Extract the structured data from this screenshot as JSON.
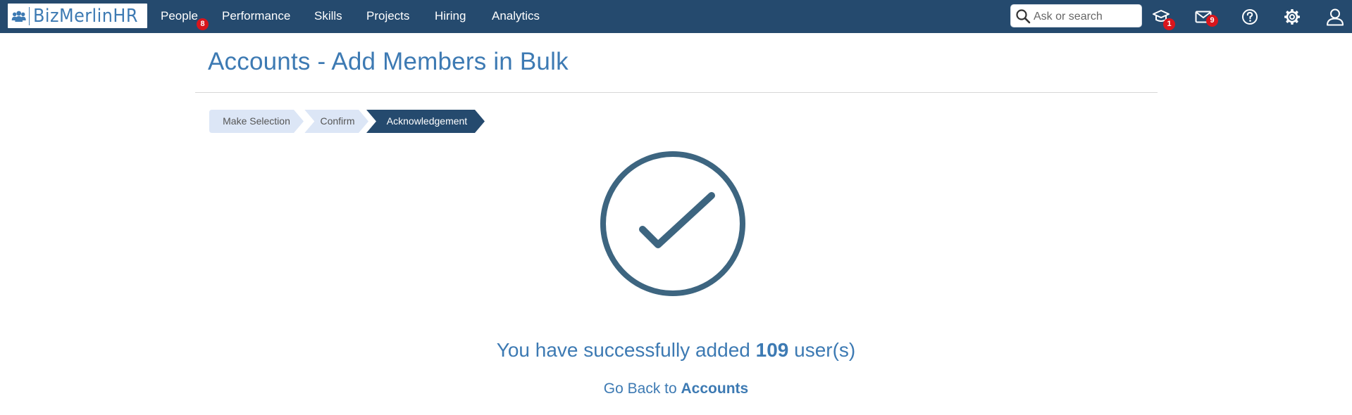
{
  "brand": {
    "logo_text": "BizMerlinHR"
  },
  "nav": {
    "items": [
      {
        "label": "People",
        "badge": "8"
      },
      {
        "label": "Performance"
      },
      {
        "label": "Skills"
      },
      {
        "label": "Projects"
      },
      {
        "label": "Hiring"
      },
      {
        "label": "Analytics"
      }
    ]
  },
  "search": {
    "placeholder": "Ask or search"
  },
  "header_icons": {
    "training": {
      "icon": "graduation-cap-icon",
      "badge": "1"
    },
    "messages": {
      "icon": "envelope-icon",
      "badge": "9"
    },
    "help": {
      "icon": "question-circle-icon"
    },
    "settings": {
      "icon": "gear-icon"
    },
    "profile": {
      "icon": "user-icon"
    }
  },
  "page": {
    "title": "Accounts - Add Members in Bulk",
    "steps": [
      {
        "label": "Make Selection",
        "state": "done"
      },
      {
        "label": "Confirm",
        "state": "done"
      },
      {
        "label": "Acknowledgement",
        "state": "active"
      }
    ],
    "success": {
      "prefix": "You have successfully added ",
      "count": "109",
      "suffix": " user(s)"
    },
    "back": {
      "prefix": "Go Back to ",
      "link": "Accounts"
    }
  },
  "colors": {
    "navbar": "#254a6e",
    "accent": "#3d7ab3",
    "badge": "#d9151c",
    "step_done": "#dce6f6",
    "step_active": "#254a6e",
    "check": "#3d6580"
  }
}
